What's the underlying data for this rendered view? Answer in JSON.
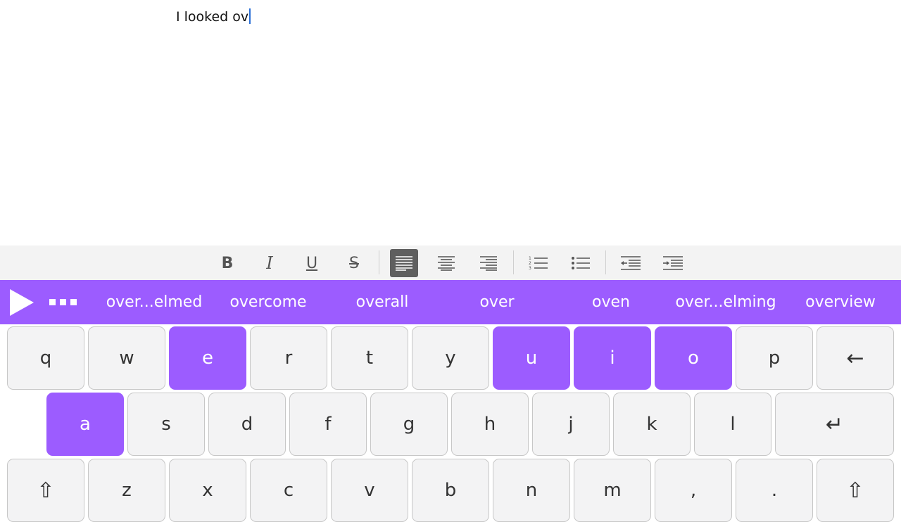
{
  "editor": {
    "text": "I looked ov"
  },
  "toolbar": {
    "bold": "B",
    "italic": "I",
    "underline": "U",
    "strikethrough": "S"
  },
  "suggestions": [
    "over...elmed",
    "overcome",
    "overall",
    "over",
    "oven",
    "over...elming",
    "overview"
  ],
  "keyboard": {
    "row1": [
      "q",
      "w",
      "e",
      "r",
      "t",
      "y",
      "u",
      "i",
      "o",
      "p",
      "←"
    ],
    "row2": [
      "a",
      "s",
      "d",
      "f",
      "g",
      "h",
      "j",
      "k",
      "l",
      "↵"
    ],
    "row3": [
      "⇧",
      "z",
      "x",
      "c",
      "v",
      "b",
      "n",
      "m",
      ",",
      ".",
      "⇧"
    ],
    "highlighted_keys": [
      "e",
      "u",
      "i",
      "o",
      "a"
    ]
  },
  "colors": {
    "accent": "#9c5cff",
    "caret": "#2a6fd6",
    "toolbar_bg": "#f3f3f3",
    "key_bg": "#f3f3f4"
  }
}
